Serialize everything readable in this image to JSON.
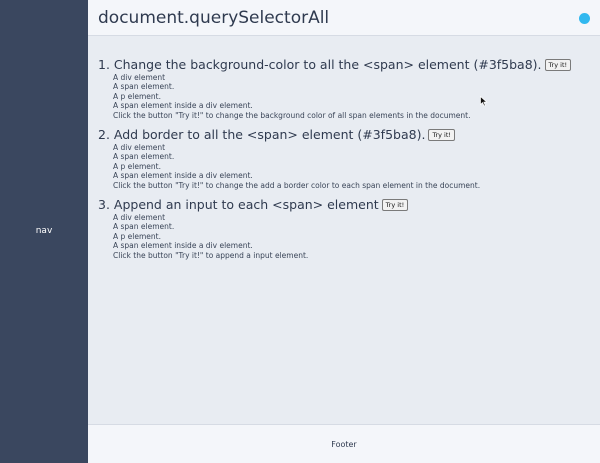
{
  "nav": {
    "label": "nav",
    "background": "#3a475f"
  },
  "header": {
    "title": "document.querySelectorAll",
    "status_color": "#31b8ef"
  },
  "sections": [
    {
      "heading": "1. Change the background-color to all the <span> element (#3f5ba8).",
      "button": "Try it!",
      "lines": [
        "A div element",
        "A span element.",
        "A p element.",
        "A span element inside a div element.",
        "Click the button \"Try it!\" to change the background color of all span elements in the document."
      ]
    },
    {
      "heading": "2. Add border to all the <span> element (#3f5ba8).",
      "button": "Try it!",
      "lines": [
        "A div element",
        "A span element.",
        "A p element.",
        "A span element inside a div element.",
        "Click the button \"Try it!\" to change the add a border color to each span element in the document."
      ]
    },
    {
      "heading": "3. Append an input to each <span> element",
      "button": "Try it!",
      "lines": [
        "A div element",
        "A span element.",
        "A p element.",
        "A span element inside a div element.",
        "Click the button \"Try it!\" to append a input element."
      ]
    }
  ],
  "footer": {
    "label": "Footer"
  },
  "icons": {
    "cursor": "mouse-pointer-icon"
  }
}
